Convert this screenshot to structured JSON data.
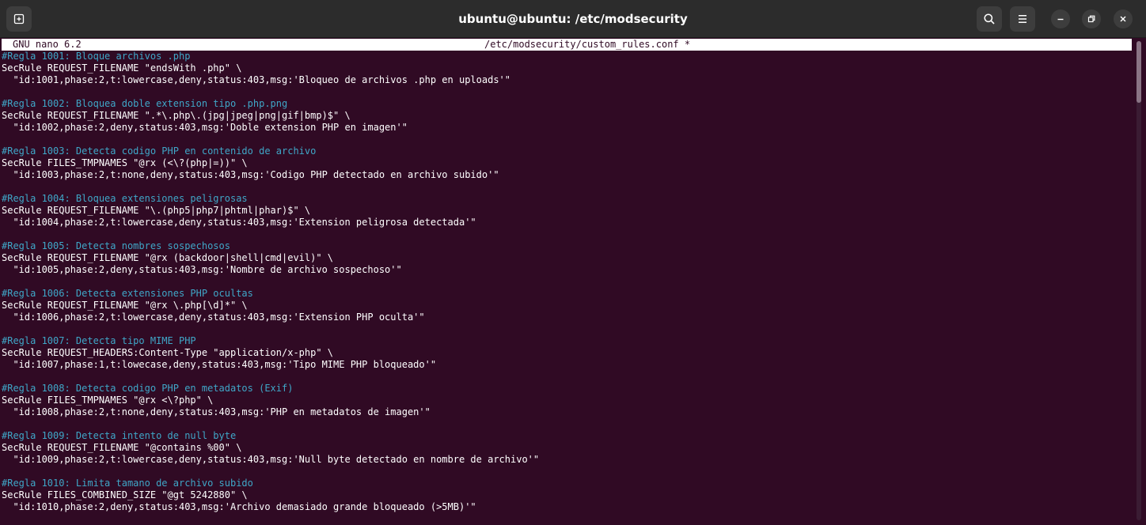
{
  "window": {
    "title": "ubuntu@ubuntu: /etc/modsecurity"
  },
  "titlebar": {
    "new_tab_icon": "new-tab-icon",
    "search_icon": "search-icon",
    "menu_icon": "hamburger-menu-icon",
    "minimize_icon": "minimize-icon",
    "restore_icon": "restore-icon",
    "close_icon": "close-icon"
  },
  "nano": {
    "version": "GNU nano 6.2",
    "filename": "/etc/modsecurity/custom_rules.conf *"
  },
  "colors": {
    "background": "#300a24",
    "comment": "#3fa7c8",
    "text": "#ffffff"
  },
  "lines": [
    {
      "text": "#Regla 1001: Bloque archivos .php",
      "type": "comment"
    },
    {
      "text": "SecRule REQUEST_FILENAME \"endsWith .php\" \\",
      "type": "code"
    },
    {
      "text": "  \"id:1001,phase:2,t:lowercase,deny,status:403,msg:'Bloqueo de archivos .php en uploads'\"",
      "type": "code"
    },
    {
      "text": "",
      "type": "code"
    },
    {
      "text": "#Regla 1002: Bloquea doble extension tipo .php.png",
      "type": "comment"
    },
    {
      "text": "SecRule REQUEST_FILENAME \".*\\.php\\.(jpg|jpeg|png|gif|bmp)$\" \\",
      "type": "code"
    },
    {
      "text": "  \"id:1002,phase:2,deny,status:403,msg:'Doble extension PHP en imagen'\"",
      "type": "code"
    },
    {
      "text": "",
      "type": "code"
    },
    {
      "text": "#Regla 1003: Detecta codigo PHP en contenido de archivo",
      "type": "comment"
    },
    {
      "text": "SecRule FILES_TMPNAMES \"@rx (<\\?(php|=))\" \\",
      "type": "code"
    },
    {
      "text": "  \"id:1003,phase:2,t:none,deny,status:403,msg:'Codigo PHP detectado en archivo subido'\"",
      "type": "code"
    },
    {
      "text": "",
      "type": "code"
    },
    {
      "text": "#Regla 1004: Bloquea extensiones peligrosas",
      "type": "comment"
    },
    {
      "text": "SecRule REQUEST_FILENAME \"\\.(php5|php7|phtml|phar)$\" \\",
      "type": "code"
    },
    {
      "text": "  \"id:1004,phase:2,t:lowercase,deny,status:403,msg:'Extension peligrosa detectada'\"",
      "type": "code"
    },
    {
      "text": "",
      "type": "code"
    },
    {
      "text": "#Regla 1005: Detecta nombres sospechosos",
      "type": "comment"
    },
    {
      "text": "SecRule REQUEST_FILENAME \"@rx (backdoor|shell|cmd|evil)\" \\",
      "type": "code"
    },
    {
      "text": "  \"id:1005,phase:2,deny,status:403,msg:'Nombre de archivo sospechoso'\"",
      "type": "code"
    },
    {
      "text": "",
      "type": "code"
    },
    {
      "text": "#Regla 1006: Detecta extensiones PHP ocultas",
      "type": "comment"
    },
    {
      "text": "SecRule REQUEST_FILENAME \"@rx \\.php[\\d]*\" \\",
      "type": "code"
    },
    {
      "text": "  \"id:1006,phase:2,t:lowercase,deny,status:403,msg:'Extension PHP oculta'\"",
      "type": "code"
    },
    {
      "text": "",
      "type": "code"
    },
    {
      "text": "#Regla 1007: Detecta tipo MIME PHP",
      "type": "comment"
    },
    {
      "text": "SecRule REQUEST_HEADERS:Content-Type \"application/x-php\" \\",
      "type": "code"
    },
    {
      "text": "  \"id:1007,phase:1,t:lowecase,deny,status:403,msg:'Tipo MIME PHP bloqueado'\"",
      "type": "code"
    },
    {
      "text": "",
      "type": "code"
    },
    {
      "text": "#Regla 1008: Detecta codigo PHP en metadatos (Exif)",
      "type": "comment"
    },
    {
      "text": "SecRule FILES_TMPNAMES \"@rx <\\?php\" \\",
      "type": "code"
    },
    {
      "text": "  \"id:1008,phase:2,t:none,deny,status:403,msg:'PHP en metadatos de imagen'\"",
      "type": "code"
    },
    {
      "text": "",
      "type": "code"
    },
    {
      "text": "#Regla 1009: Detecta intento de null byte",
      "type": "comment"
    },
    {
      "text": "SecRule REQUEST_FILENAME \"@contains %00\" \\",
      "type": "code"
    },
    {
      "text": "  \"id:1009,phase:2,t:lowercase,deny,status:403,msg:'Null byte detectado en nombre de archivo'\"",
      "type": "code"
    },
    {
      "text": "",
      "type": "code"
    },
    {
      "text": "#Regla 1010: Limita tamano de archivo subido",
      "type": "comment"
    },
    {
      "text": "SecRule FILES_COMBINED_SIZE \"@gt 5242880\" \\",
      "type": "code"
    },
    {
      "text": "  \"id:1010,phase:2,deny,status:403,msg:'Archivo demasiado grande bloqueado (>5MB)'\"",
      "type": "code"
    }
  ]
}
